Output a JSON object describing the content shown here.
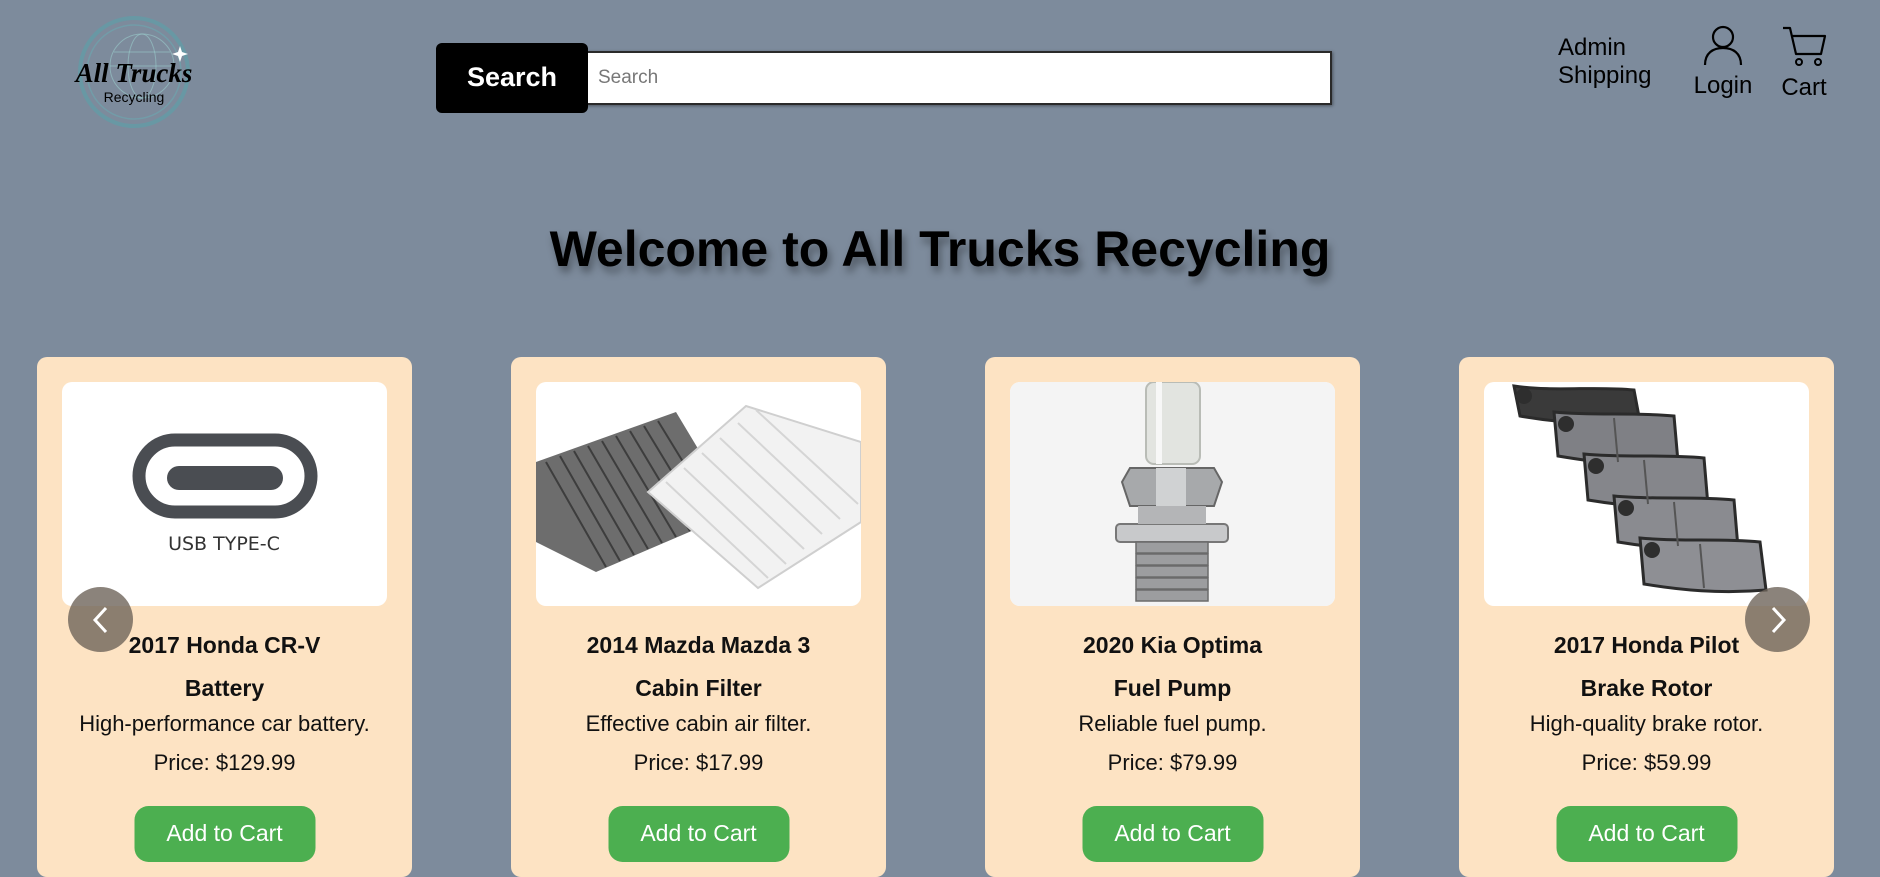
{
  "logo": {
    "brand": "All Trucks",
    "sub": "Recycling"
  },
  "search": {
    "button_label": "Search",
    "placeholder": "Search",
    "value": ""
  },
  "nav": {
    "admin": "Admin",
    "shipping": "Shipping",
    "login": "Login",
    "cart": "Cart"
  },
  "page_title": "Welcome to All Trucks Recycling",
  "products": [
    {
      "line1": "2017 Honda CR-V",
      "line2": "Battery",
      "desc": "High-performance car battery.",
      "price": "Price: $129.99",
      "button": "Add to Cart",
      "image_text": "USB TYPE-C"
    },
    {
      "line1": "2014 Mazda Mazda 3",
      "line2": "Cabin Filter",
      "desc": "Effective cabin air filter.",
      "price": "Price: $17.99",
      "button": "Add to Cart"
    },
    {
      "line1": "2020 Kia Optima",
      "line2": "Fuel Pump",
      "desc": "Reliable fuel pump.",
      "price": "Price: $79.99",
      "button": "Add to Cart"
    },
    {
      "line1": "2017 Honda Pilot",
      "line2": "Brake Rotor",
      "desc": "High-quality brake rotor.",
      "price": "Price: $59.99",
      "button": "Add to Cart"
    }
  ],
  "colors": {
    "background": "#7d8b9c",
    "card": "#fde3c3",
    "add_button": "#4caf50",
    "search_button": "#000000"
  },
  "icons": {
    "user": "user-icon",
    "cart": "cart-icon",
    "prev": "chevron-left-icon",
    "next": "chevron-right-icon"
  }
}
